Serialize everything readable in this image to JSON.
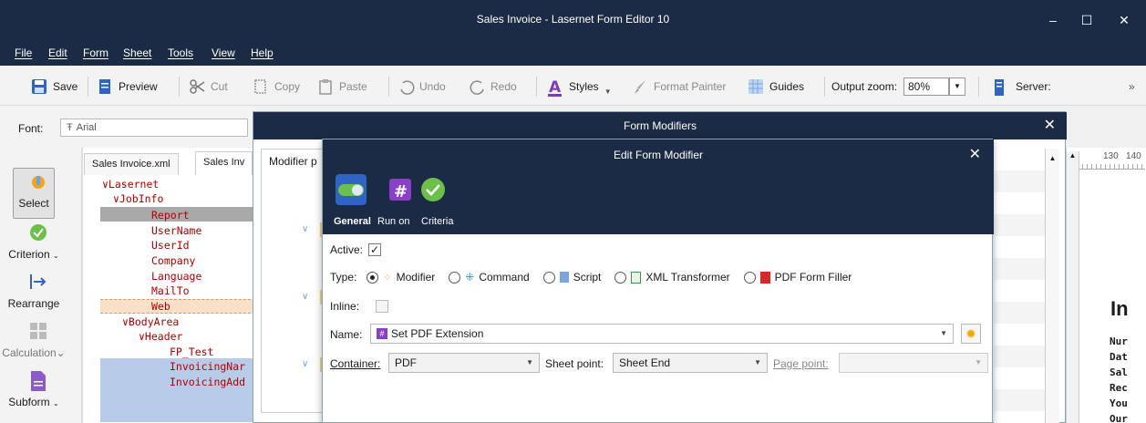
{
  "window": {
    "title": "Sales Invoice - Lasernet Form Editor 10",
    "minimize": "–",
    "maximize": "☐",
    "close": "✕"
  },
  "menu": [
    "File",
    "Edit",
    "Form",
    "Sheet",
    "Tools",
    "View",
    "Help"
  ],
  "toolbar": {
    "save": "Save",
    "preview": "Preview",
    "cut": "Cut",
    "copy": "Copy",
    "paste": "Paste",
    "undo": "Undo",
    "redo": "Redo",
    "styles": "Styles",
    "format_painter": "Format Painter",
    "guides": "Guides",
    "output_zoom_label": "Output zoom:",
    "output_zoom_value": "80%",
    "server_label": "Server:",
    "overflow": "»"
  },
  "fontbar": {
    "label": "Font:",
    "value": "Arial"
  },
  "left_tools": [
    {
      "label": "Select"
    },
    {
      "label": "Criterion"
    },
    {
      "label": "Rearrange"
    },
    {
      "label": "Calculation"
    },
    {
      "label": "Subform"
    }
  ],
  "doc_tabs": [
    "Sales Invoice.xml",
    "Sales Inv"
  ],
  "tree": [
    {
      "text": "∨Lasernet",
      "indent": 0
    },
    {
      "text": "∨JobInfo",
      "indent": 1
    },
    {
      "text": "Report",
      "indent": 3
    },
    {
      "text": "UserName",
      "indent": 3
    },
    {
      "text": "UserId",
      "indent": 3
    },
    {
      "text": "Company",
      "indent": 3
    },
    {
      "text": "Language",
      "indent": 3
    },
    {
      "text": "MailTo",
      "indent": 3
    },
    {
      "text": "Web",
      "indent": 3
    },
    {
      "text": "∨BodyArea",
      "indent": 1
    },
    {
      "text": "∨Header",
      "indent": 2
    },
    {
      "text": "FP_Test",
      "indent": 4
    },
    {
      "text": "InvoicingNar",
      "indent": 4
    },
    {
      "text": "InvoicingAdd",
      "indent": 4
    }
  ],
  "form_modifiers": {
    "title": "Form Modifiers",
    "close": "✕",
    "column_header": "Modifier p"
  },
  "edit_modifier": {
    "title": "Edit Form Modifier",
    "close": "✕",
    "tabs": [
      "General",
      "Run on",
      "Criteria"
    ],
    "active_label": "Active:",
    "active_checked": "✓",
    "type_label": "Type:",
    "types": [
      "Modifier",
      "Command",
      "Script",
      "XML Transformer",
      "PDF Form Filler"
    ],
    "inline_label": "Inline:",
    "name_label": "Name:",
    "name_value": "Set PDF Extension",
    "container_label": "Container:",
    "container_value": "PDF",
    "sheet_point_label": "Sheet point:",
    "sheet_point_value": "Sheet End",
    "page_point_label": "Page point:",
    "page_point_value": ""
  },
  "canvas": {
    "ruler": "130   140",
    "heading": "In",
    "lines": [
      "Nur",
      "Dat",
      "Sal",
      "Rec",
      "You",
      "Our"
    ]
  },
  "colors": {
    "titlebar": "#1c2b45",
    "tree_text": "#b10000",
    "accent": "#2f63c5"
  }
}
